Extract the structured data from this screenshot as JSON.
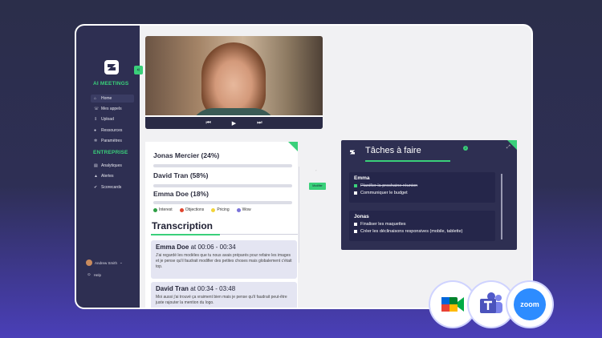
{
  "sidebar": {
    "sections": [
      {
        "title": "AI MEETINGS",
        "items": [
          {
            "label": "Home",
            "icon": "home-icon",
            "active": true
          },
          {
            "label": "Mes appels",
            "icon": "phone-icon"
          },
          {
            "label": "Upload",
            "icon": "upload-icon"
          },
          {
            "label": "Ressources",
            "icon": "book-icon"
          },
          {
            "label": "Paramètres",
            "icon": "gear-icon"
          }
        ]
      },
      {
        "title": "ENTREPRISE",
        "items": [
          {
            "label": "Analytiques",
            "icon": "chart-icon"
          },
          {
            "label": "Alertes",
            "icon": "bell-icon"
          },
          {
            "label": "Scorecards",
            "icon": "target-icon"
          }
        ]
      }
    ],
    "user_name": "Andrew Smith",
    "help_label": "Help"
  },
  "speakers": [
    {
      "label": "Jonas Mercier (24%)",
      "share": 0.24
    },
    {
      "label": "David Tran (58%)",
      "share": 0.58
    },
    {
      "label": "Emma Doe (18%)",
      "share": 0.18
    }
  ],
  "legend": [
    {
      "label": "Interest",
      "color": "#2e9e44"
    },
    {
      "label": "Objections",
      "color": "#e0452e"
    },
    {
      "label": "Pricing",
      "color": "#f2d43a"
    },
    {
      "label": "Wow",
      "color": "#7a73d9"
    }
  ],
  "transcription": {
    "title": "Transcription",
    "entries": [
      {
        "speaker": "Emma Doe",
        "at": "at",
        "time": "00:06 - 00:34",
        "text": "J'ai regardé les modèles que tu nous avais préparés pour refaire les images et je pense qu'il faudrait modifier des petites choses mais globalement c'était top."
      },
      {
        "speaker": "David Tran",
        "at": "at",
        "time": "00:34 - 03:48",
        "text": "Moi aussi j'ai trouvé ça vraiment bien mais je pense qu'il faudrait peut-être juste rajouter la mention du logo."
      }
    ]
  },
  "modifier_label": "Modifier",
  "tasks": {
    "title": "Tâches à faire",
    "count": "2",
    "groups": [
      {
        "name": "Emma",
        "items": [
          {
            "text": "Planifier la prochaine réunion",
            "done": true
          },
          {
            "text": "Communiquer le budget",
            "done": false
          }
        ]
      },
      {
        "name": "Jonas",
        "items": [
          {
            "text": "Finaliser les maquettes",
            "done": false
          },
          {
            "text": "Créer les déclinaisons responsives (mobile, tablette)",
            "done": false
          }
        ]
      }
    ]
  },
  "integrations": {
    "zoom_label": "zoom",
    "apps": [
      "google-meet-icon",
      "microsoft-teams-icon",
      "zoom-icon"
    ]
  },
  "colors": {
    "accent": "#3ad07a",
    "sidebar": "#2e2f52",
    "background": "#2b2e4a"
  }
}
